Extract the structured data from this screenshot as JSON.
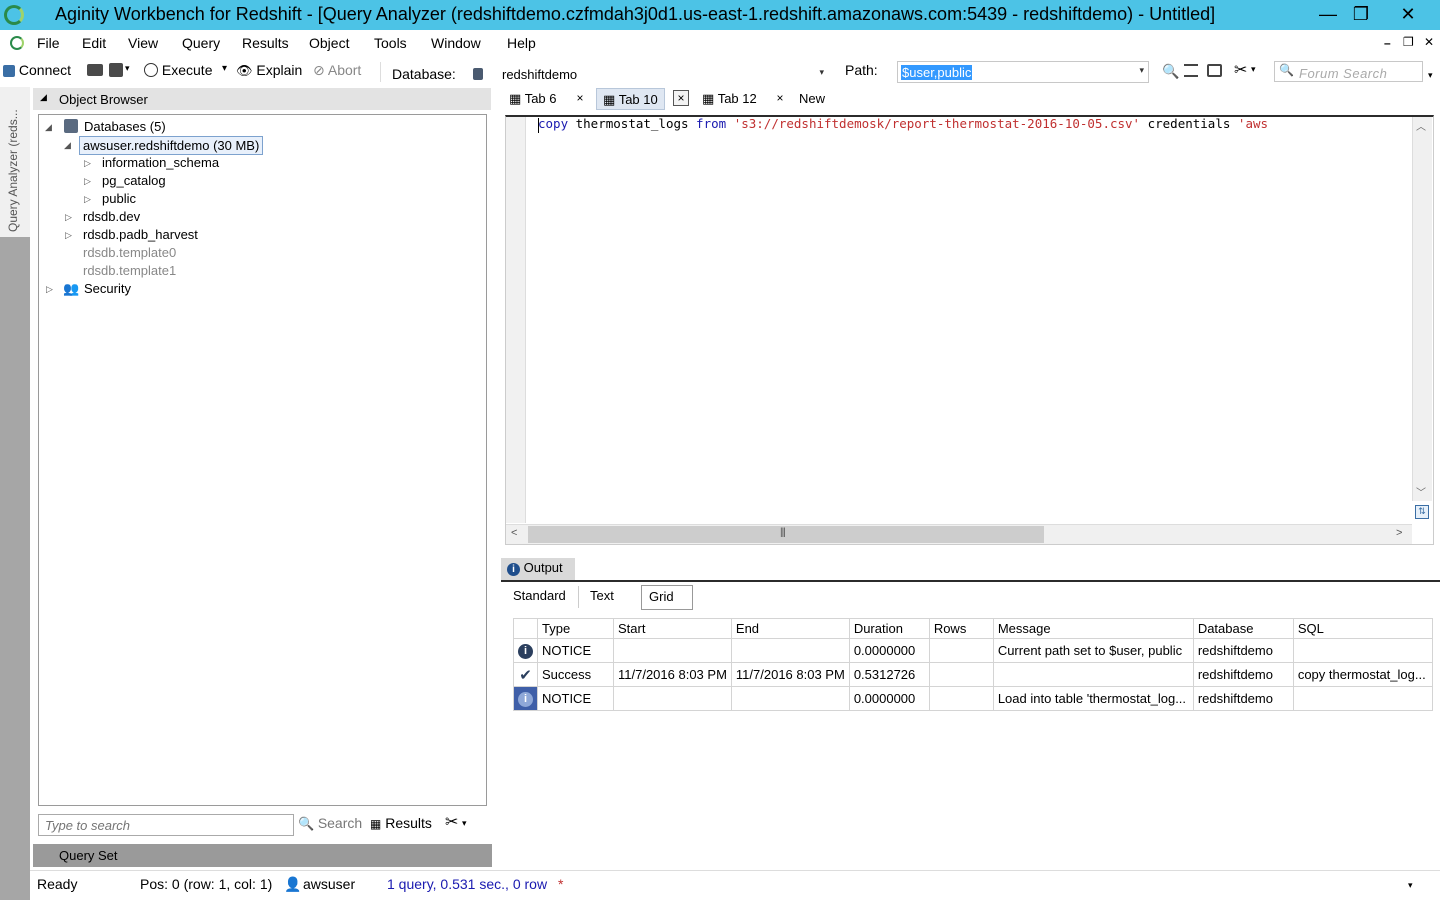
{
  "window": {
    "title": "Aginity Workbench for Redshift - [Query Analyzer (redshiftdemo.czfmdah3j0d1.us-east-1.redshift.amazonaws.com:5439 - redshiftdemo) - Untitled]",
    "minimize": "—",
    "restore": "❐",
    "close": "✕"
  },
  "menu": [
    "File",
    "Edit",
    "View",
    "Query",
    "Results",
    "Object",
    "Tools",
    "Window",
    "Help"
  ],
  "mdi_controls": {
    "minimize": "–",
    "restore": "❐",
    "close": "✕"
  },
  "toolbar": {
    "connect": "Connect",
    "execute": "Execute",
    "explain": "Explain",
    "abort": "Abort",
    "database_label": "Database:",
    "database_value": "redshiftdemo",
    "path_label": "Path:",
    "path_value": "$user,public",
    "forum_search_placeholder": "Forum Search"
  },
  "side_strip_label": "Query Analyzer (reds...",
  "object_browser": {
    "title": "Object Browser",
    "databases": "Databases (5)",
    "selected_db": "awsuser.redshiftdemo (30 MB)",
    "schemas": [
      "information_schema",
      "pg_catalog",
      "public"
    ],
    "other_dbs": [
      "rdsdb.dev",
      "rdsdb.padb_harvest"
    ],
    "templates": [
      "rdsdb.template0",
      "rdsdb.template1"
    ],
    "security": "Security",
    "search_placeholder": "Type to search",
    "search_button": "Search",
    "results_button": "Results",
    "query_set": "Query Set"
  },
  "tabs": {
    "tab6": "Tab 6",
    "tab10": "Tab 10",
    "tab12": "Tab 12",
    "new": "New",
    "close": "×"
  },
  "editor": {
    "kw_copy": "copy",
    "table": " thermostat_logs ",
    "kw_from": "from",
    "space": " ",
    "s3_path": "'s3://redshiftdemosk/report-thermostat-2016-10-05.csv'",
    "credentials": " credentials ",
    "aws": "'aws"
  },
  "output": {
    "title": "Output",
    "tabs": [
      "Standard",
      "Text",
      "Grid"
    ],
    "columns": [
      "Type",
      "Start",
      "End",
      "Duration",
      "Rows",
      "Message",
      "Database",
      "SQL"
    ],
    "rows": [
      {
        "icon": "info-icon",
        "type": "NOTICE",
        "start": "",
        "end": "",
        "duration": "0.0000000",
        "rows": "",
        "message": "Current path set to $user, public",
        "database": "redshiftdemo",
        "sql": ""
      },
      {
        "icon": "check-icon",
        "type": "Success",
        "start": "11/7/2016 8:03 PM",
        "end": "11/7/2016 8:03 PM",
        "duration": "0.5312726",
        "rows": "",
        "message": "",
        "database": "redshiftdemo",
        "sql": "copy thermostat_log..."
      },
      {
        "icon": "info-icon",
        "type": "NOTICE",
        "start": "",
        "end": "",
        "duration": "0.0000000",
        "rows": "",
        "message": "Load into table 'thermostat_log...",
        "database": "redshiftdemo",
        "sql": ""
      }
    ]
  },
  "status": {
    "ready": "Ready",
    "position": "Pos: 0 (row: 1, col: 1)",
    "user": "awsuser",
    "query_info": "1 query, 0.531 sec., 0 row",
    "modified": "*"
  },
  "colors": {
    "titlebar": "#4cc3e6",
    "keyword": "#1a1ab0",
    "string": "#c03030",
    "status_link": "#1a1ab0",
    "selection": "#3399ff"
  }
}
